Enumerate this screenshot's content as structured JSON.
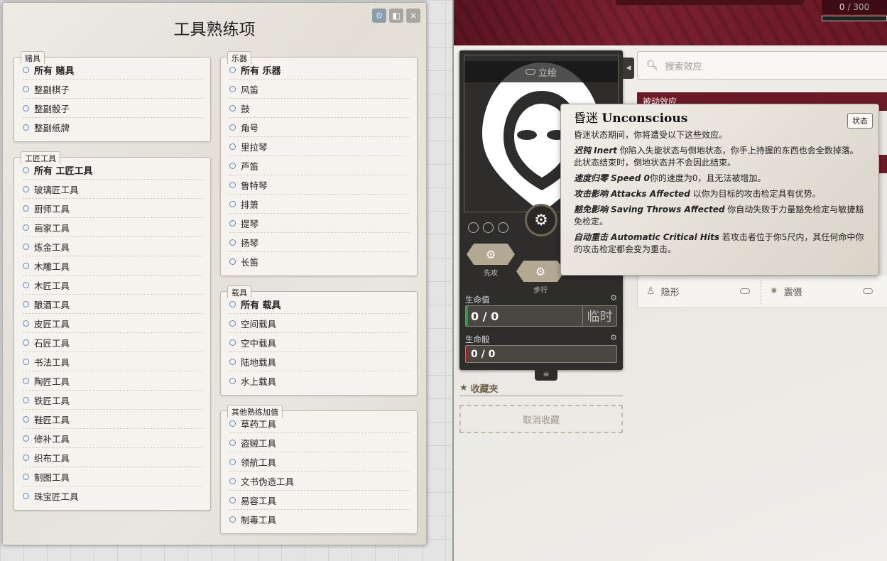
{
  "dialog": {
    "title": "工具熟练项",
    "buttons": {
      "settings": "⚙",
      "copy": "◧",
      "close": "×"
    }
  },
  "groups": {
    "gaming": {
      "label": "赌具",
      "items": [
        "所有 赌具",
        "整副棋子",
        "整副骰子",
        "整副纸牌"
      ]
    },
    "artisan": {
      "label": "工匠工具",
      "items": [
        "所有 工匠工具",
        "玻璃匠工具",
        "厨师工具",
        "画家工具",
        "炼金工具",
        "木雕工具",
        "木匠工具",
        "酿酒工具",
        "皮匠工具",
        "石匠工具",
        "书法工具",
        "陶匠工具",
        "铁匠工具",
        "鞋匠工具",
        "修补工具",
        "织布工具",
        "制图工具",
        "珠宝匠工具"
      ]
    },
    "music": {
      "label": "乐器",
      "items": [
        "所有 乐器",
        "风笛",
        "鼓",
        "角号",
        "里拉琴",
        "芦笛",
        "鲁特琴",
        "排箫",
        "提琴",
        "扬琴",
        "长笛"
      ]
    },
    "vehicle": {
      "label": "载具",
      "items": [
        "所有 载具",
        "空间载具",
        "空中载具",
        "陆地载具",
        "水上载具"
      ]
    },
    "other": {
      "label": "其他熟练加值",
      "items": [
        "草药工具",
        "盗贼工具",
        "领航工具",
        "文书伪造工具",
        "易容工具",
        "制毒工具"
      ]
    }
  },
  "sheet": {
    "xp_current": "0",
    "xp_max": "/ 300",
    "portrait_toggle": "立绘",
    "initiative_label": "先攻",
    "movement_label": "步行",
    "hp_label": "生命值",
    "hp_value": "0 / 0",
    "hp_temp": "临时",
    "hit_dice_label": "生命骰",
    "hit_dice_value": "0 / 0",
    "favorites_title": "收藏夹",
    "favorites_drop": "取消收藏",
    "search_placeholder": "搜索效应",
    "effects_header": "被动效应",
    "effects": [
      {
        "label": "隐形",
        "icon": "invisible-icon"
      },
      {
        "label": "震慑",
        "icon": "stunned-icon"
      }
    ]
  },
  "tooltip": {
    "title_cn": "昏迷",
    "title_en": "Unconscious",
    "badge": "状态",
    "intro": "昏迷状态期间，你将遭受以下这些效应。",
    "paragraphs": [
      {
        "lead": "迟钝 Inert",
        "text": " 你陷入失能状态与倒地状态，你手上持握的东西也会全数掉落。此状态结束时，倒地状态并不会因此结束。"
      },
      {
        "lead": "速度归零 Speed 0",
        "text": "你的速度为0，且无法被增加。"
      },
      {
        "lead": "攻击影响 Attacks Affected",
        "text": " 以你为目标的攻击检定具有优势。"
      },
      {
        "lead": "豁免影响 Saving Throws Affected",
        "text": " 你自动失败于力量豁免检定与敏捷豁免检定。"
      },
      {
        "lead": "自动重击 Automatic Critical Hits",
        "text": " 若攻击者位于你5尺内，其任何命中你的攻击检定都会变为重击。"
      }
    ]
  },
  "colors": {
    "accent": "#6d1a28",
    "radio": "#5a86c4",
    "hex": "#b3a892"
  }
}
